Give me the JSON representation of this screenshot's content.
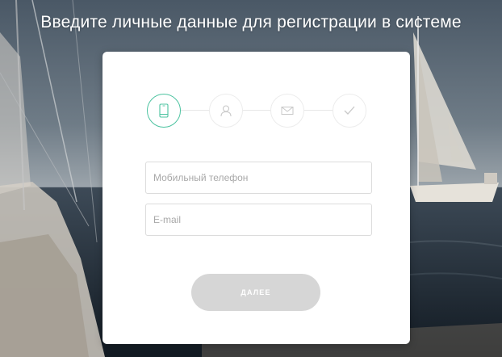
{
  "page": {
    "headline": "Введите личные данные для регистрации в системе"
  },
  "steps": [
    {
      "icon": "mobile-phone-icon",
      "active": true
    },
    {
      "icon": "user-icon",
      "active": false
    },
    {
      "icon": "envelope-icon",
      "active": false
    },
    {
      "icon": "checkmark-icon",
      "active": false
    }
  ],
  "form": {
    "phone_placeholder": "Мобильный телефон",
    "phone_value": "",
    "email_placeholder": "E-mail",
    "email_value": "",
    "next_label": "ДАЛЕЕ"
  },
  "colors": {
    "accent": "#4cc3a0",
    "button_disabled": "#d6d6d6",
    "card_bg": "#ffffff"
  }
}
